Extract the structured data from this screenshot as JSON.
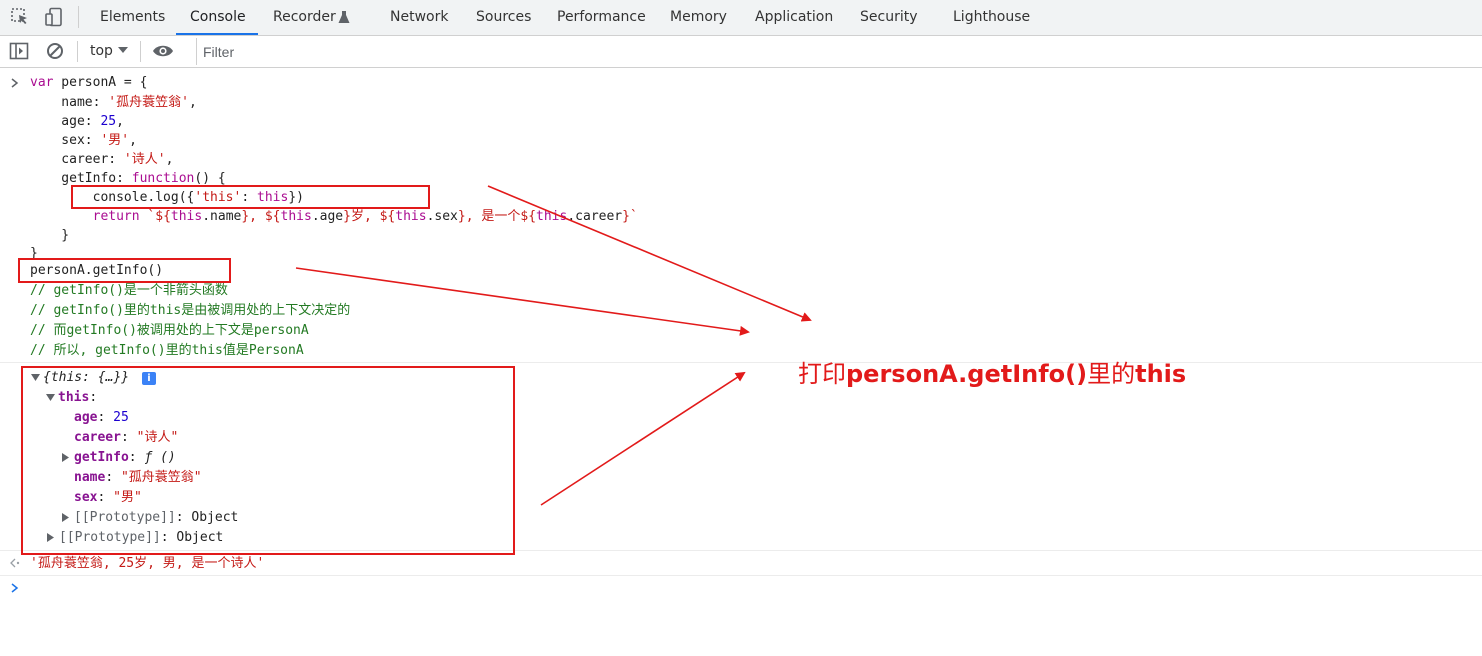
{
  "tabs": [
    {
      "label": "Elements"
    },
    {
      "label": "Console",
      "active": true
    },
    {
      "label": "Recorder"
    },
    {
      "label": "Network"
    },
    {
      "label": "Sources"
    },
    {
      "label": "Performance"
    },
    {
      "label": "Memory"
    },
    {
      "label": "Application"
    },
    {
      "label": "Security"
    },
    {
      "label": "Lighthouse"
    }
  ],
  "toolbar": {
    "context": "top",
    "filter_placeholder": "Filter"
  },
  "input": {
    "lines": [
      "var personA = {",
      "    name: '孤舟蓑笠翁',",
      "    age: 25,",
      "    sex: '男',",
      "    career: '诗人',",
      "    getInfo: function() {",
      "        console.log({'this': this})",
      "        return `${this.name}, ${this.age}岁, ${this.sex}, 是一个${this.career}`",
      "    }",
      "}",
      "personA.getInfo()",
      "// getInfo()是一个非箭头函数",
      "// getInfo()里的this是由被调用处的上下文决定的",
      "// 而getInfo()被调用处的上下文是personA",
      "// 所以, getInfo()里的this值是PersonA"
    ]
  },
  "output": {
    "summary": "{this: {…}}",
    "this_key": "this",
    "props": [
      {
        "key": "age",
        "value": "25"
      },
      {
        "key": "career",
        "value": "\"诗人\""
      },
      {
        "key": "getInfo",
        "value": "ƒ ()"
      },
      {
        "key": "name",
        "value": "\"孤舟蓑笠翁\""
      },
      {
        "key": "sex",
        "value": "\"男\""
      }
    ],
    "prototype_inner": "[[Prototype]]",
    "prototype_inner_value": "Object",
    "prototype_outer": "[[Prototype]]",
    "prototype_outer_value": "Object"
  },
  "result": "'孤舟蓑笠翁, 25岁, 男, 是一个诗人'",
  "annotation": {
    "prefix": "打印",
    "call": "personA.getInfo()",
    "middle": "里的",
    "target": "this"
  },
  "colors": {
    "annotation_red": "#e21a1a",
    "tab_accent": "#1a73e8"
  }
}
